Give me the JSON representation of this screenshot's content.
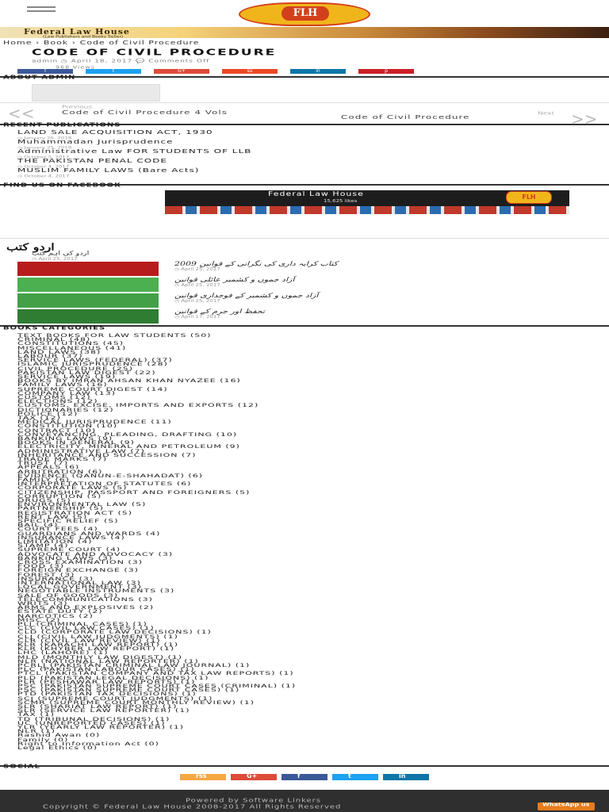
{
  "header": {
    "logo_text": "FLH",
    "banner_title": "Federal Law House",
    "banner_sub": "(Law Publishers and Books Seller)"
  },
  "breadcrumb": "Home   ›   Book  ›   Code of Civil Procedure",
  "post": {
    "title": "CODE OF CIVIL PROCEDURE",
    "meta": "admin     ◷ April 18, 2017     💬 Comments Off",
    "views": "968 Views"
  },
  "share": {
    "buttons": [
      {
        "name": "facebook",
        "glyph": "f",
        "color": "#3b5998"
      },
      {
        "name": "twitter",
        "glyph": "t",
        "color": "#1da1f2"
      },
      {
        "name": "googleplus",
        "glyph": "G+",
        "color": "#dd4b39"
      },
      {
        "name": "stumbleupon",
        "glyph": "su",
        "color": "#eb4924"
      },
      {
        "name": "linkedin",
        "glyph": "in",
        "color": "#0e76a8"
      },
      {
        "name": "pinterest",
        "glyph": "p",
        "color": "#cb2027"
      }
    ]
  },
  "about": {
    "heading": "ABOUT ADMIN"
  },
  "pager": {
    "prev_label": "Previous",
    "prev_title": "Code of Civil Procedure 4 Vols",
    "next_label": "Next",
    "next_title": "Code of Civil Procedure",
    "prev_arrow": "<<",
    "next_arrow": ">>"
  },
  "recent": {
    "heading": "RECENT PUBLICATIONS",
    "items": [
      {
        "title": "LAND SALE ACQUISITION ACT, 1930",
        "date": "◷ January 26, 2018"
      },
      {
        "title": "Muhammadan Jurisprudence",
        "date": "◷ January 25, 2018"
      },
      {
        "title": "Administrative Law FOR STUDENTS OF LLB",
        "date": "◷ October 5, 2017"
      },
      {
        "title": "THE PAKISTAN PENAL CODE",
        "date": "◷ October 4, 2017"
      },
      {
        "title": "MUSLIM FAMILY LAWS (Bare Acts)",
        "date": "◷ October 4, 2017"
      }
    ]
  },
  "facebook": {
    "heading": "FIND US ON FACEBOOK",
    "page_name": "Federal Law House",
    "likes": "15,625 likes",
    "logo_text": "FLH"
  },
  "urdu": {
    "heading": "اردو کتب",
    "subheading": "اردو کی اہم کتب",
    "sub_date": "◷ April 25, 2017",
    "items": [
      {
        "title": "کتاب کرایہ داری کی نگرانی کے قوانین 2009",
        "date": "◷ April 25, 2017",
        "color": "#b71c1c"
      },
      {
        "title": "آزاد جموں و کشمیر عائلی قوانین",
        "date": "◷ April 25, 2017",
        "color": "#4caf50"
      },
      {
        "title": "آزاد جموں و کشمیر کے فوجداری قوانین",
        "date": "◷ April 25, 2017",
        "color": "#43a047"
      },
      {
        "title": "تحفظ اور جرم کے قوانین",
        "date": "◷ April 17, 2017",
        "color": "#2e7d32"
      }
    ]
  },
  "categories": {
    "heading": "BOOKS CATEGORIES",
    "items": [
      "TEXT BOOKS FOR LAW STUDENTS (50)",
      "CRIMINAL (48)",
      "CONSTITUTIONS (45)",
      "MISCELLANEOUS (41)",
      "LAND LAWS (38)",
      "LABOUR (37)",
      "SERVICE LAWS (FEDERAL) (37)",
      "ISLAMIC JURISPRUDENCE (28)",
      "CIVIL PROCEDURE (25)",
      "PAKISTAN LAW DIGEST (22)",
      "SERVICE LAWS (19)",
      "BOOKS BY IMRAN AHSAN KHAN NYAZEE (16)",
      "FAMILY LAWS (16)",
      "SUPREME COURT DIGEST (14)",
      "COMPANY LAW (13)",
      "CUSTOMS (12)",
      "ELECTIONS (12)",
      "CUSTOMS, EXCISE, IMPORTS AND EXPORTS (12)",
      "DICTIONARIES (12)",
      "POLICE (12)",
      "TAX (12)",
      "MEDICAL JURISPRUDENCE (11)",
      "CONSTITUTION (10)",
      "CONTRACT (10)",
      "CONVEYANCING, PLEADING, DRAFTING (10)",
      "BANKING LAWS (9)",
      "BOOKS IN GENERAL (9)",
      "ELECTRICITY, MINERAL AND PETROLEUM (9)",
      "ADMINISTRATIVE LAW (7)",
      "INHERITANCE AND SUCCESSION (7)",
      "TRADE MARKS (7)",
      "TRUST (7)",
      "APPEALS (6)",
      "ARBITRATION (6)",
      "EVIDENCE (QANUN-E-SHAHADAT) (6)",
      "FAMILY (6)",
      "INTERPRETATION OF STATUTES (6)",
      "CORPORATE LAWS (5)",
      "CITIZENSHIP, PASSPORT AND FOREIGNERS (5)",
      "CORRUPTION (5)",
      "DRUGS (5)",
      "ENVIRONMENTAL LAW (5)",
      "PARTNERSHIP (5)",
      "REGISTRATION ACT (5)",
      "RENT LAW (5)",
      "SPECIFIC RELIEF (5)",
      "BAIL (4)",
      "COURT FEES (4)",
      "GUARDIANS AND WARDS (4)",
      "INSURANCE LAWS (4)",
      "LIMITATION (4)",
      "STAMP (4)",
      "SUPREME COURT (4)",
      "ADVOCATE AND ADVOCACY (3)",
      "BANKING LAWS (3)",
      "CROSS EXAMINATION (3)",
      "FOOD (3)",
      "FOREIGN EXCHANGE (3)",
      "FOREST (3)",
      "INSURANCE (3)",
      "INTERNATIONAL LAW (3)",
      "LOCAL GOVERNMENT (3)",
      "NEGOTIABLE INSTRUMENTS (3)",
      "SALE OF GOODS (3)",
      "TELECOMMUNICATIONS (3)",
      "WRITS (3)",
      "ARMS AND EXPLOSIVES (2)",
      "ESTATE DUTY (2)",
      "NARCOTICS (2)",
      "MISC (2)",
      "PLJ (CRIMINAL CASES) (1)",
      "CLC (CIVIL LAW CASES) (1)",
      "CLD (CORPORATE LAW DECISIONS) (1)",
      "CLJ (CIVIL LAW JUDGMENTS) (1)",
      "CLR (CIVIL LAW REVIEW) (1)",
      "KLR (KARACHI LAW REPORT) (1)",
      "KLR (KHYBER LAW REPORT) (1)",
      "LHC (LAHORE) (1)",
      "MLD (MONTHLY LAW DIGEST) (1)",
      "NLR (NATIONAL LAW REPORTER) (1)",
      "PCRLJ (PAKISTAN CRIMINAL LAW JOURNAL) (1)",
      "PLC (PAKISTAN LABOUR CASES) (1)",
      "PTCL (PAKISTAN COMPANY AND TAX LAW REPORTS) (1)",
      "PLD (PAKISTAN LEGAL DECISIONS) (1)",
      "PLR (PESHAWAR LAW REPORTS) (1)",
      "PSC (PAKISTAN SUPREME COURT CASES (CRIMINAL) (1)",
      "PSC (PAKISTAN SUPREME COURT CASES) (1)",
      "PTD (PAKISTAN TAX DECISIONS) (1)",
      "SCJ (SUPREME COURT JUDGMENTS) (1)",
      "SCMR (SUPREME COURT MONTHLY REVIEW) (1)",
      "SLR (SHARIAT LAW REPORT) (1)",
      "SLR (SERVICE LAW REPORTER) (1)",
      "TAX (1)",
      "TD (TRIBUNAL DECISIONS) (1)",
      "UC (UNREPORTED CASES) (1)",
      "YLR (YEARLY LAW REPORTER) (1)",
      "NLR (1)",
      "Rashid Awan (0)",
      "Family (0)",
      "Right to Information Act (0)",
      "Legal Ethics (0)"
    ]
  },
  "social": {
    "heading": "SOCIAL",
    "buttons": [
      {
        "name": "rss",
        "glyph": "rss",
        "color": "#f4a742"
      },
      {
        "name": "googleplus",
        "glyph": "G+",
        "color": "#dd4b39"
      },
      {
        "name": "facebook",
        "glyph": "f",
        "color": "#3b5998"
      },
      {
        "name": "twitter",
        "glyph": "t",
        "color": "#1da1f2"
      },
      {
        "name": "linkedin",
        "glyph": "in",
        "color": "#0e76a8"
      }
    ]
  },
  "footer": {
    "line1": "Powered by Software Linkers",
    "line2": "Copyright © Federal Law House 2008-2017 All Rights Reserved",
    "whatsapp": "WhatsApp us"
  }
}
